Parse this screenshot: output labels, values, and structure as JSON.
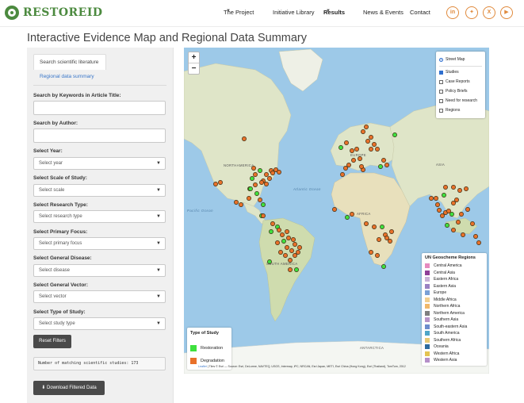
{
  "header": {
    "logo_text": "RESTOREID",
    "nav": [
      {
        "label": "The Project",
        "has_caret": true
      },
      {
        "label": "Initiative Library",
        "has_caret": false
      },
      {
        "label": "Results",
        "has_caret": true,
        "active": true
      },
      {
        "label": "News & Events",
        "has_caret": false
      },
      {
        "label": "Contact",
        "has_caret": false
      }
    ],
    "social_icons": [
      "in",
      "bf",
      "X",
      "yt"
    ]
  },
  "page_title": "Interactive Evidence Map and Regional Data Summary",
  "sidebar": {
    "tabs": [
      "Search scientific literature",
      "Regional data summary"
    ],
    "keywords_label": "Search by Keywords in Article Title:",
    "keywords_value": "",
    "author_label": "Search by Author:",
    "author_value": "",
    "filters": [
      {
        "label": "Select Year:",
        "placeholder": "Select year"
      },
      {
        "label": "Select Scale of Study:",
        "placeholder": "Select scale"
      },
      {
        "label": "Select Research Type:",
        "placeholder": "Select research type"
      },
      {
        "label": "Select Primary Focus:",
        "placeholder": "Select primary focus"
      },
      {
        "label": "Select General Disease:",
        "placeholder": "Select disease"
      },
      {
        "label": "Select General Vector:",
        "placeholder": "Select vector"
      },
      {
        "label": "Select Type of Study:",
        "placeholder": "Select study type"
      }
    ],
    "reset_label": "Reset Filters",
    "count_text": "Number of matching scientific studies: 173",
    "download_label": "Download Filtered Data"
  },
  "map": {
    "zoom_in": "+",
    "zoom_out": "−",
    "base_layer": "Street Map",
    "overlays": [
      {
        "label": "Studies",
        "checked": true
      },
      {
        "label": "Case Reports",
        "checked": false
      },
      {
        "label": "Policy Briefs",
        "checked": false
      },
      {
        "label": "Need for research",
        "checked": false
      },
      {
        "label": "Regions",
        "checked": false
      }
    ],
    "labels": {
      "north_america": "NORTHAMERICA",
      "south_america": "SOUTH AMERICA",
      "europe": "EUROPE",
      "africa": "AFRICA",
      "asia": "ASIA",
      "antarctica": "ANTARCTICA",
      "atlantic": "Atlantic Ocean",
      "pacific": "Pacific Ocean"
    },
    "type_legend": {
      "title": "Type of Study",
      "items": [
        {
          "label": "Restoration",
          "color": "#3ee03e"
        },
        {
          "label": "Degradation",
          "color": "#e8712a"
        }
      ]
    },
    "regions_legend": {
      "title": "UN Geoscheme Regions",
      "items": [
        {
          "label": "Central America",
          "color": "#e58bbf"
        },
        {
          "label": "Central Asia",
          "color": "#8f3f98"
        },
        {
          "label": "Eastern Africa",
          "color": "#c9b2d8"
        },
        {
          "label": "Eastern Asia",
          "color": "#9a82c2"
        },
        {
          "label": "Europe",
          "color": "#7aa0d6"
        },
        {
          "label": "Middle Africa",
          "color": "#f2cf8f"
        },
        {
          "label": "Northern Africa",
          "color": "#f0b86a"
        },
        {
          "label": "Northern America",
          "color": "#7f7f7f"
        },
        {
          "label": "Southern Asia",
          "color": "#b794c8"
        },
        {
          "label": "South-eastern Asia",
          "color": "#6d8ccc"
        },
        {
          "label": "South America",
          "color": "#4fa6c8"
        },
        {
          "label": "Southern Africa",
          "color": "#e8ca73"
        },
        {
          "label": "Oceania",
          "color": "#2d6b9e"
        },
        {
          "label": "Western Africa",
          "color": "#e3c452"
        },
        {
          "label": "Western Asia",
          "color": "#b58fc9"
        }
      ]
    },
    "attribution_leaflet": "Leaflet",
    "attribution": "| Tiles © Esri — Source: Esri, DeLorme, NAVTEQ, USGS, Intermap, iPC, NRCAN, Esri Japan, METI, Esri China (Hong Kong), Esri (Thailand), TomTom, 2012"
  }
}
